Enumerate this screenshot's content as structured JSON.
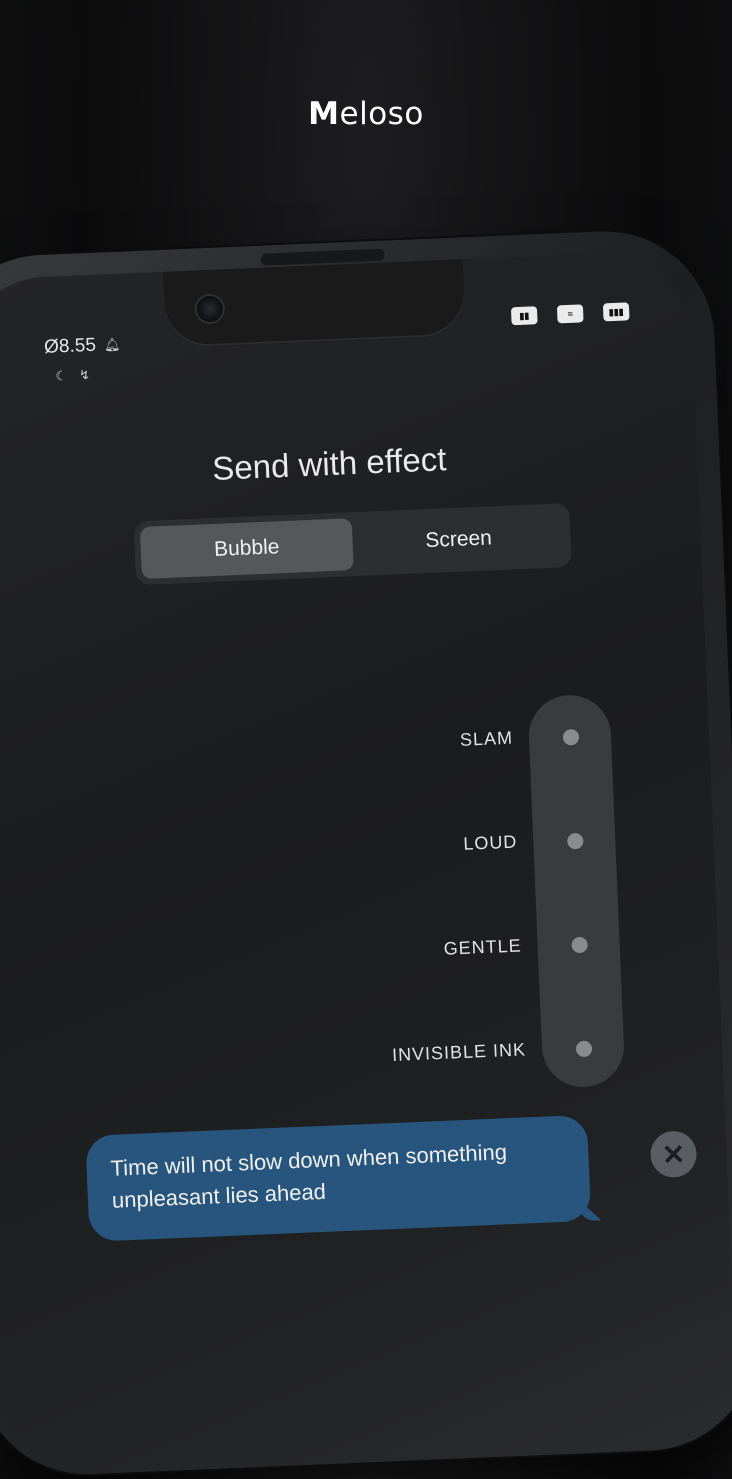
{
  "brand": {
    "initial": "M",
    "rest": "eloso"
  },
  "status_bar": {
    "time": "Ø8.55",
    "bell_icon": "bell-icon",
    "sub_icons": [
      "moon-icon",
      "mute-icon"
    ],
    "right_icons": [
      "signal-icon",
      "wifi-icon",
      "battery-icon"
    ]
  },
  "screen": {
    "title": "Send with effect",
    "tabs": [
      {
        "label": "Bubble",
        "active": true
      },
      {
        "label": "Screen",
        "active": false
      }
    ],
    "effects": [
      {
        "label": "SLAM"
      },
      {
        "label": "LOUD"
      },
      {
        "label": "GENTLE"
      },
      {
        "label": "INVISIBLE INK"
      }
    ],
    "message": "Time will not slow down when something unpleasant lies ahead",
    "close_icon": "close-icon"
  },
  "colors": {
    "bubble": "#27557d",
    "active_tab": "#55575b",
    "track": "#3a3b3e"
  }
}
